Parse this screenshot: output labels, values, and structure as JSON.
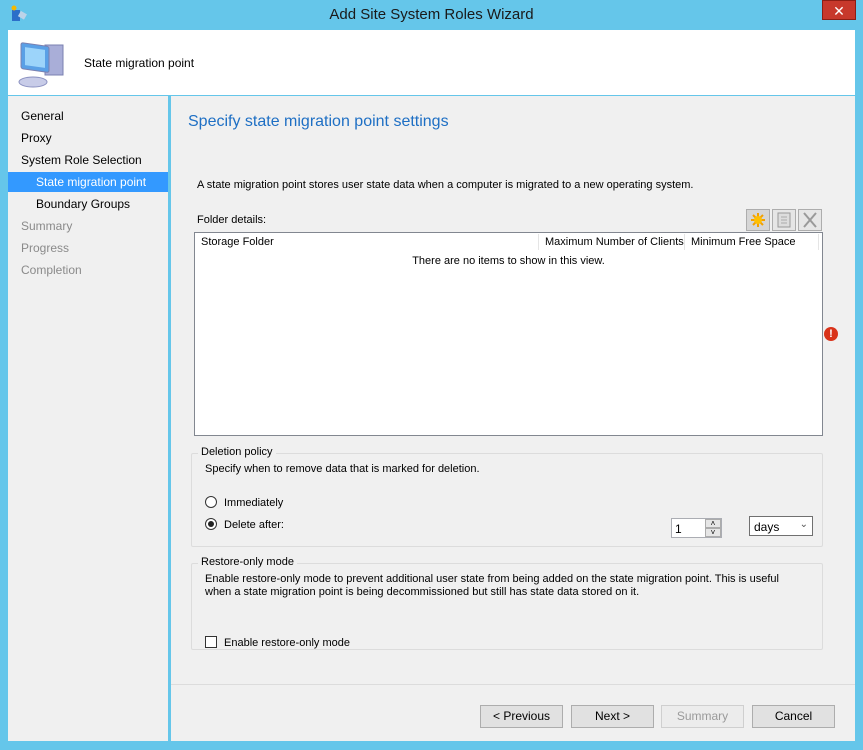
{
  "window": {
    "title": "Add Site System Roles Wizard",
    "close": "✕"
  },
  "header": {
    "title": "State migration point"
  },
  "nav": [
    {
      "label": "General",
      "state": "normal"
    },
    {
      "label": "Proxy",
      "state": "normal"
    },
    {
      "label": "System Role Selection",
      "state": "normal"
    },
    {
      "label": "State migration point",
      "state": "selected"
    },
    {
      "label": "Boundary Groups",
      "state": "normal"
    },
    {
      "label": "Summary",
      "state": "disabled"
    },
    {
      "label": "Progress",
      "state": "disabled"
    },
    {
      "label": "Completion",
      "state": "disabled"
    }
  ],
  "main": {
    "heading": "Specify state migration point settings",
    "description": "A state migration point stores user state data when a computer is migrated to a new operating system.",
    "folder_label": "Folder details:",
    "toolbar": [
      "new-icon",
      "properties-icon",
      "delete-icon"
    ],
    "columns": [
      "Storage Folder",
      "Maximum Number of Clients",
      "Minimum Free Space"
    ],
    "empty": "There are no items to show in this view.",
    "error_icon": "!",
    "deletion": {
      "title": "Deletion policy",
      "desc": "Specify when to remove data that is marked for deletion.",
      "immediately": "Immediately",
      "delete_after": "Delete after:",
      "selected": "delete_after",
      "value": "1",
      "unit": "days"
    },
    "restore": {
      "title": "Restore-only mode",
      "desc": "Enable restore-only mode to prevent additional user state from being added on the state migration point.  This is useful when a state migration point is being decommissioned but still has state data stored on it.",
      "checkbox": "Enable restore-only mode",
      "checked": false
    }
  },
  "buttons": {
    "previous": "< Previous",
    "next": "Next >",
    "summary": "Summary",
    "cancel": "Cancel"
  }
}
